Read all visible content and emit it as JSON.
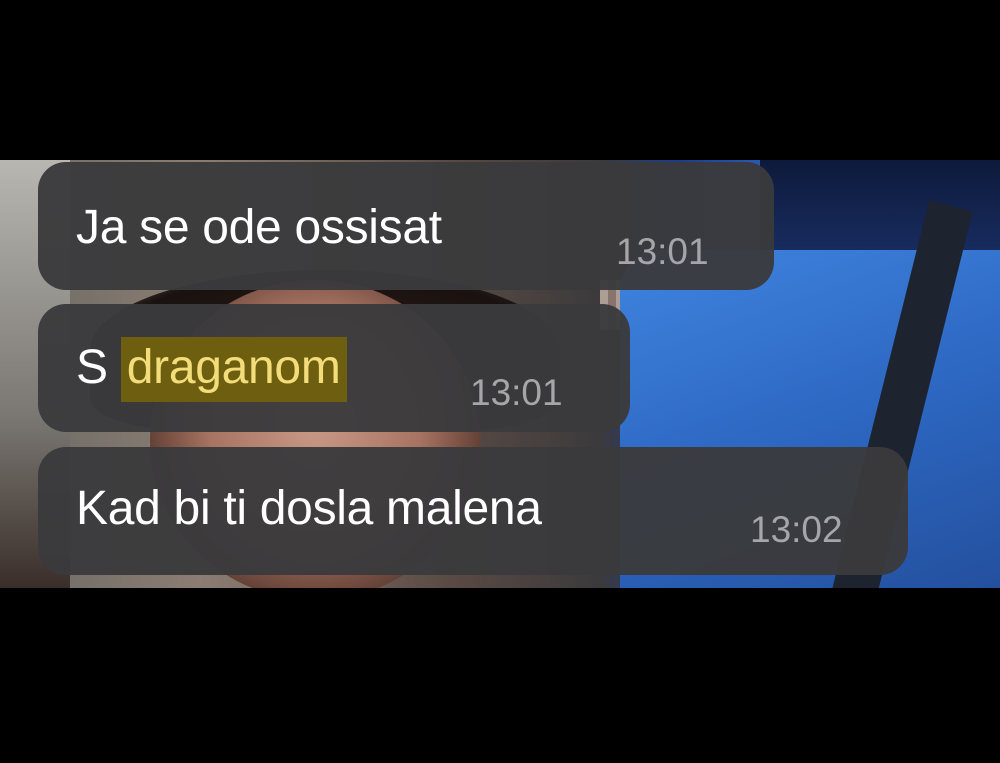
{
  "messages": [
    {
      "text": "Ja se ode ossisat",
      "time": "13:01"
    },
    {
      "prefix": "S",
      "highlight": "draganom",
      "time": "13:01"
    },
    {
      "text": "Kad bi ti dosla malena",
      "time": "13:02"
    }
  ],
  "colors": {
    "bubble": "#3a3a3c",
    "highlight_bg": "#6e5f10",
    "highlight_text": "#f3dd7a",
    "timestamp": "#a6a6aa"
  }
}
